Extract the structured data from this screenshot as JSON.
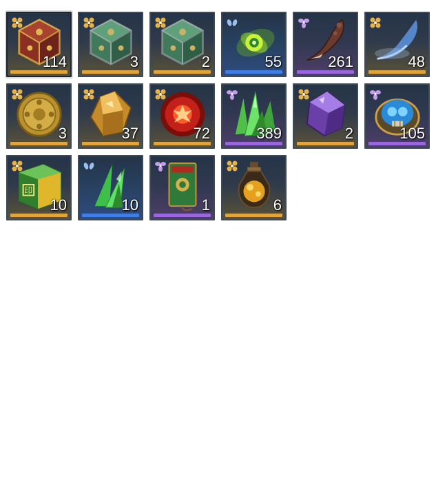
{
  "items": [
    {
      "rarity": "gold",
      "icon": "ornate-red-d20-dice-icon",
      "quantity": "114",
      "selected": true
    },
    {
      "rarity": "gold",
      "icon": "green-ornate-d20-dice-icon",
      "quantity": "3"
    },
    {
      "rarity": "gold",
      "icon": "green-ornate-d20-dice-icon",
      "quantity": "2"
    },
    {
      "rarity": "blue",
      "icon": "green-energy-orb-icon",
      "quantity": "55"
    },
    {
      "rarity": "purple",
      "icon": "bone-claw-icon",
      "quantity": "261"
    },
    {
      "rarity": "gold",
      "icon": "blue-spectral-claw-icon",
      "quantity": "48"
    },
    {
      "rarity": "gold",
      "icon": "gold-coin-icon",
      "quantity": "3"
    },
    {
      "rarity": "gold",
      "icon": "amber-gem-icon",
      "quantity": "37"
    },
    {
      "rarity": "gold",
      "icon": "red-fire-orb-icon",
      "quantity": "72"
    },
    {
      "rarity": "purple",
      "icon": "green-crystal-cluster-icon",
      "quantity": "389"
    },
    {
      "rarity": "gold",
      "icon": "purple-amethyst-icon",
      "quantity": "2"
    },
    {
      "rarity": "purple",
      "icon": "blue-crystal-skull-icon",
      "quantity": "105"
    },
    {
      "rarity": "gold",
      "icon": "jade-cube-seal-icon",
      "quantity": "10"
    },
    {
      "rarity": "blue",
      "icon": "green-crystal-shard-icon",
      "quantity": "10"
    },
    {
      "rarity": "purple",
      "icon": "green-talisman-tag-icon",
      "quantity": "1"
    },
    {
      "rarity": "gold",
      "icon": "amber-potion-bottle-icon",
      "quantity": "6"
    }
  ],
  "colors": {
    "gold": "#e0a43a",
    "purple": "#9a66e0",
    "blue": "#3f7ee6",
    "slot_border": "#3b4a5c",
    "quantity_text": "#ffffff"
  }
}
